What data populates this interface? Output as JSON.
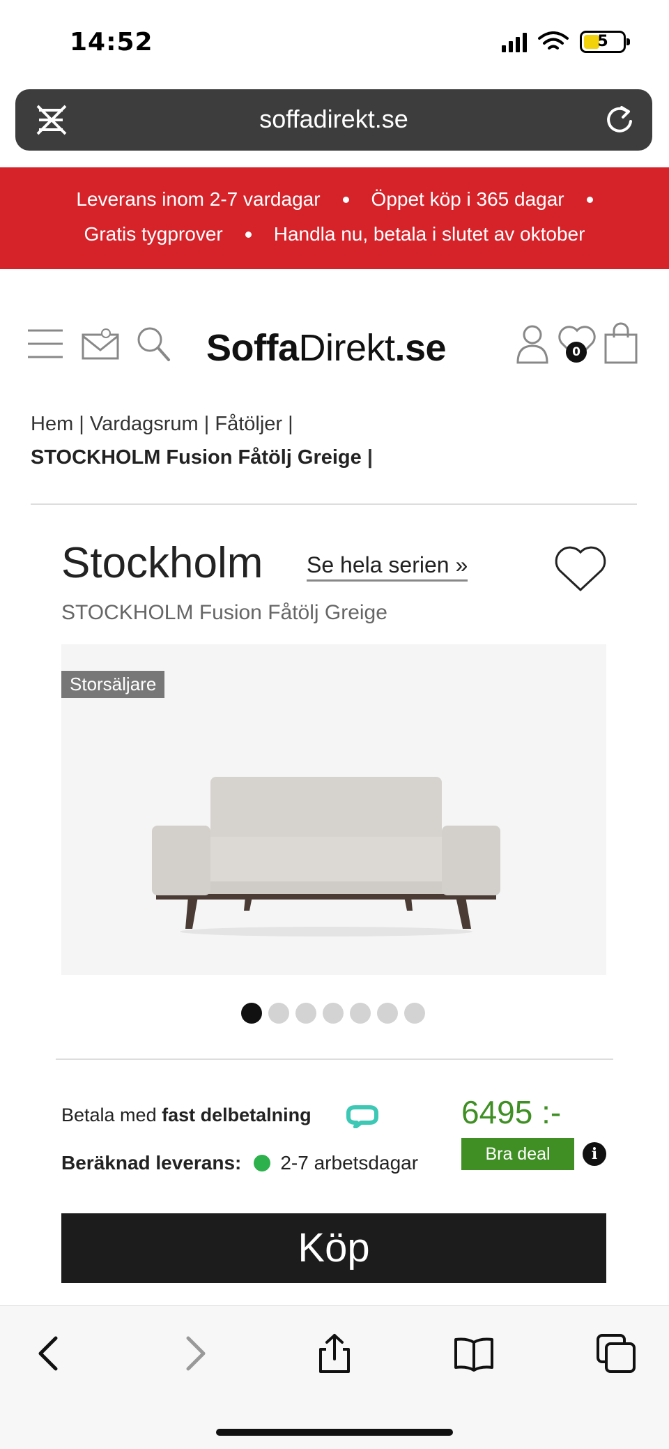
{
  "status_bar": {
    "time": "14:52",
    "battery": "5"
  },
  "browser": {
    "url": "soffadirekt.se"
  },
  "promo": {
    "items": [
      "Leverans inom 2-7 vardagar",
      "Öppet köp i 365 dagar",
      "Gratis tygprover",
      "Handla nu, betala i slutet av oktober"
    ]
  },
  "header": {
    "logo_bold": "Soffa",
    "logo_regular": "Direkt",
    "logo_suffix": ".se",
    "wishlist_count": "0",
    "icons": [
      "menu-icon",
      "mail-icon",
      "search-icon",
      "user-icon",
      "heart-icon",
      "bag-icon"
    ]
  },
  "breadcrumb": {
    "items": [
      "Hem",
      "Vardagsrum",
      "Fåtöljer"
    ],
    "current": "STOCKHOLM Fusion Fåtölj Greige"
  },
  "product": {
    "series_name": "Stockholm",
    "series_link": "Se hela serien »",
    "subtitle": "STOCKHOLM Fusion Fåtölj Greige",
    "badge": "Storsäljare",
    "image_count": 7,
    "active_image": 1,
    "payment_prefix": "Betala med",
    "payment_method": "fast delbetalning",
    "price": "6495 :-",
    "delivery_label": "Beräknad leverans:",
    "delivery_time": "2-7 arbetsdagar",
    "deal_label": "Bra deal",
    "info_glyph": "i",
    "buy_label": "Köp"
  },
  "colors": {
    "promo_bg": "#d6232a",
    "price_green": "#3f8f24",
    "buy_bg": "#1c1c1c",
    "delivery_dot": "#2db14c"
  }
}
